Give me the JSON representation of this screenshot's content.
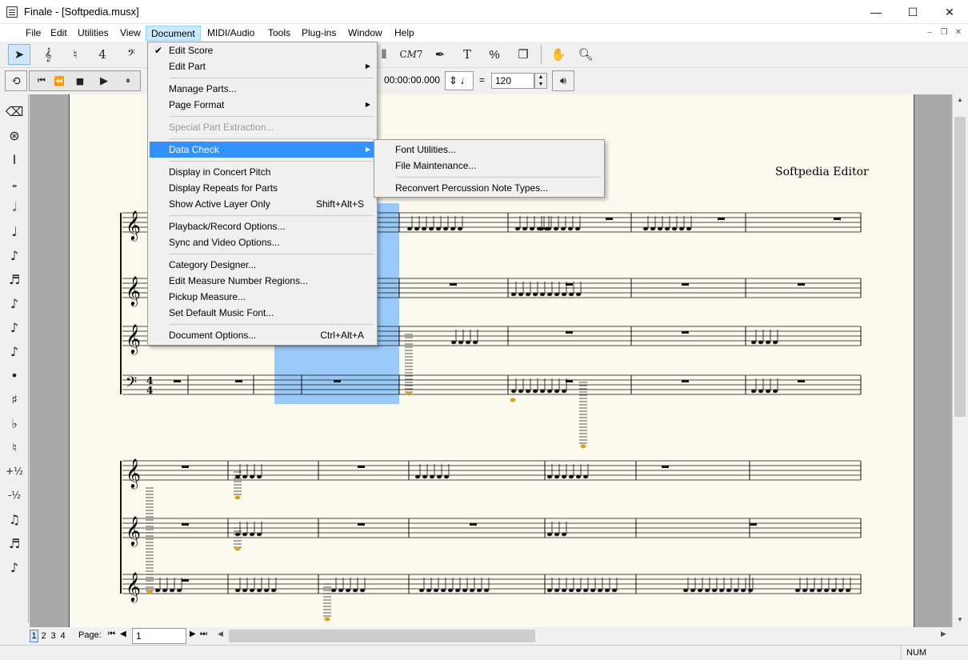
{
  "window": {
    "title": "Finale - [Softpedia.musx]",
    "minimize": "—",
    "maximize": "☐",
    "close": "✕"
  },
  "menubar": {
    "items": [
      "File",
      "Edit",
      "Utilities",
      "View",
      "Document",
      "MIDI/Audio",
      "Tools",
      "Plug-ins",
      "Window",
      "Help"
    ],
    "active": "Document"
  },
  "mdi": {
    "min": "‒",
    "restore": "❐",
    "close": "✕"
  },
  "playback": {
    "time": "00:00:00.000",
    "tempo_eq": "=",
    "tempo": "120"
  },
  "toolbar_labels": {
    "chord": "C𝑀7",
    "text": "T",
    "percent": "%"
  },
  "document_menu": [
    {
      "label": "Edit Score",
      "check": "✔"
    },
    {
      "label": "Edit Part",
      "arrow": "▶"
    },
    {
      "label": "Manage Parts..."
    },
    {
      "label": "Page Format",
      "arrow": "▶"
    },
    {
      "label": "Special Part Extraction...",
      "disabled": true
    },
    {
      "label": "Data Check",
      "arrow": "▶"
    },
    {
      "label": "Display in Concert Pitch"
    },
    {
      "label": "Display Repeats for Parts"
    },
    {
      "label": "Show Active Layer Only",
      "shortcut": "Shift+Alt+S"
    },
    {
      "label": "Playback/Record Options..."
    },
    {
      "label": "Sync and Video Options..."
    },
    {
      "label": "Category Designer..."
    },
    {
      "label": "Edit Measure Number Regions..."
    },
    {
      "label": "Pickup Measure..."
    },
    {
      "label": "Set Default Music Font..."
    },
    {
      "label": "Document Options...",
      "shortcut": "Ctrl+Alt+A"
    }
  ],
  "data_check_menu": [
    {
      "label": "Font Utilities..."
    },
    {
      "label": "File Maintenance..."
    },
    {
      "label": "Reconvert Percussion Note Types..."
    }
  ],
  "score": {
    "composer_text": "Softpedia Editor",
    "time_sig_top": "4",
    "time_sig_bottom": "4"
  },
  "palette": [
    {
      "icon": "eraser-icon",
      "glyph": "⌫"
    },
    {
      "icon": "hybrid-icon",
      "glyph": "⊛"
    },
    {
      "icon": "breve-rest-icon",
      "glyph": "Ⅰ"
    },
    {
      "icon": "whole-note-icon",
      "glyph": "𝅝"
    },
    {
      "icon": "half-note-icon",
      "glyph": "𝅗𝅥"
    },
    {
      "icon": "quarter-note-icon",
      "glyph": "♩"
    },
    {
      "icon": "eighth-note-icon",
      "glyph": "♪"
    },
    {
      "icon": "sixteenth-note-icon",
      "glyph": "♬"
    },
    {
      "icon": "thirty-second-note-icon",
      "glyph": "♪"
    },
    {
      "icon": "sixty-fourth-note-icon",
      "glyph": "♪"
    },
    {
      "icon": "hundred-twenty-eighth-icon",
      "glyph": "♪"
    },
    {
      "icon": "dot-icon",
      "glyph": "•"
    },
    {
      "icon": "sharp-icon",
      "glyph": "♯"
    },
    {
      "icon": "flat-icon",
      "glyph": "♭"
    },
    {
      "icon": "natural-icon",
      "glyph": "♮"
    },
    {
      "icon": "half-step-up-icon",
      "glyph": "+½"
    },
    {
      "icon": "half-step-down-icon",
      "glyph": "-½"
    },
    {
      "icon": "tie-icon",
      "glyph": "♫"
    },
    {
      "icon": "tuplet-icon",
      "glyph": "♬"
    },
    {
      "icon": "grace-note-icon",
      "glyph": "♪"
    }
  ],
  "page_nav": {
    "tabs": [
      "1",
      "2",
      "3",
      "4"
    ],
    "label": "Page:",
    "value": "1"
  },
  "status": {
    "num": "NUM"
  }
}
